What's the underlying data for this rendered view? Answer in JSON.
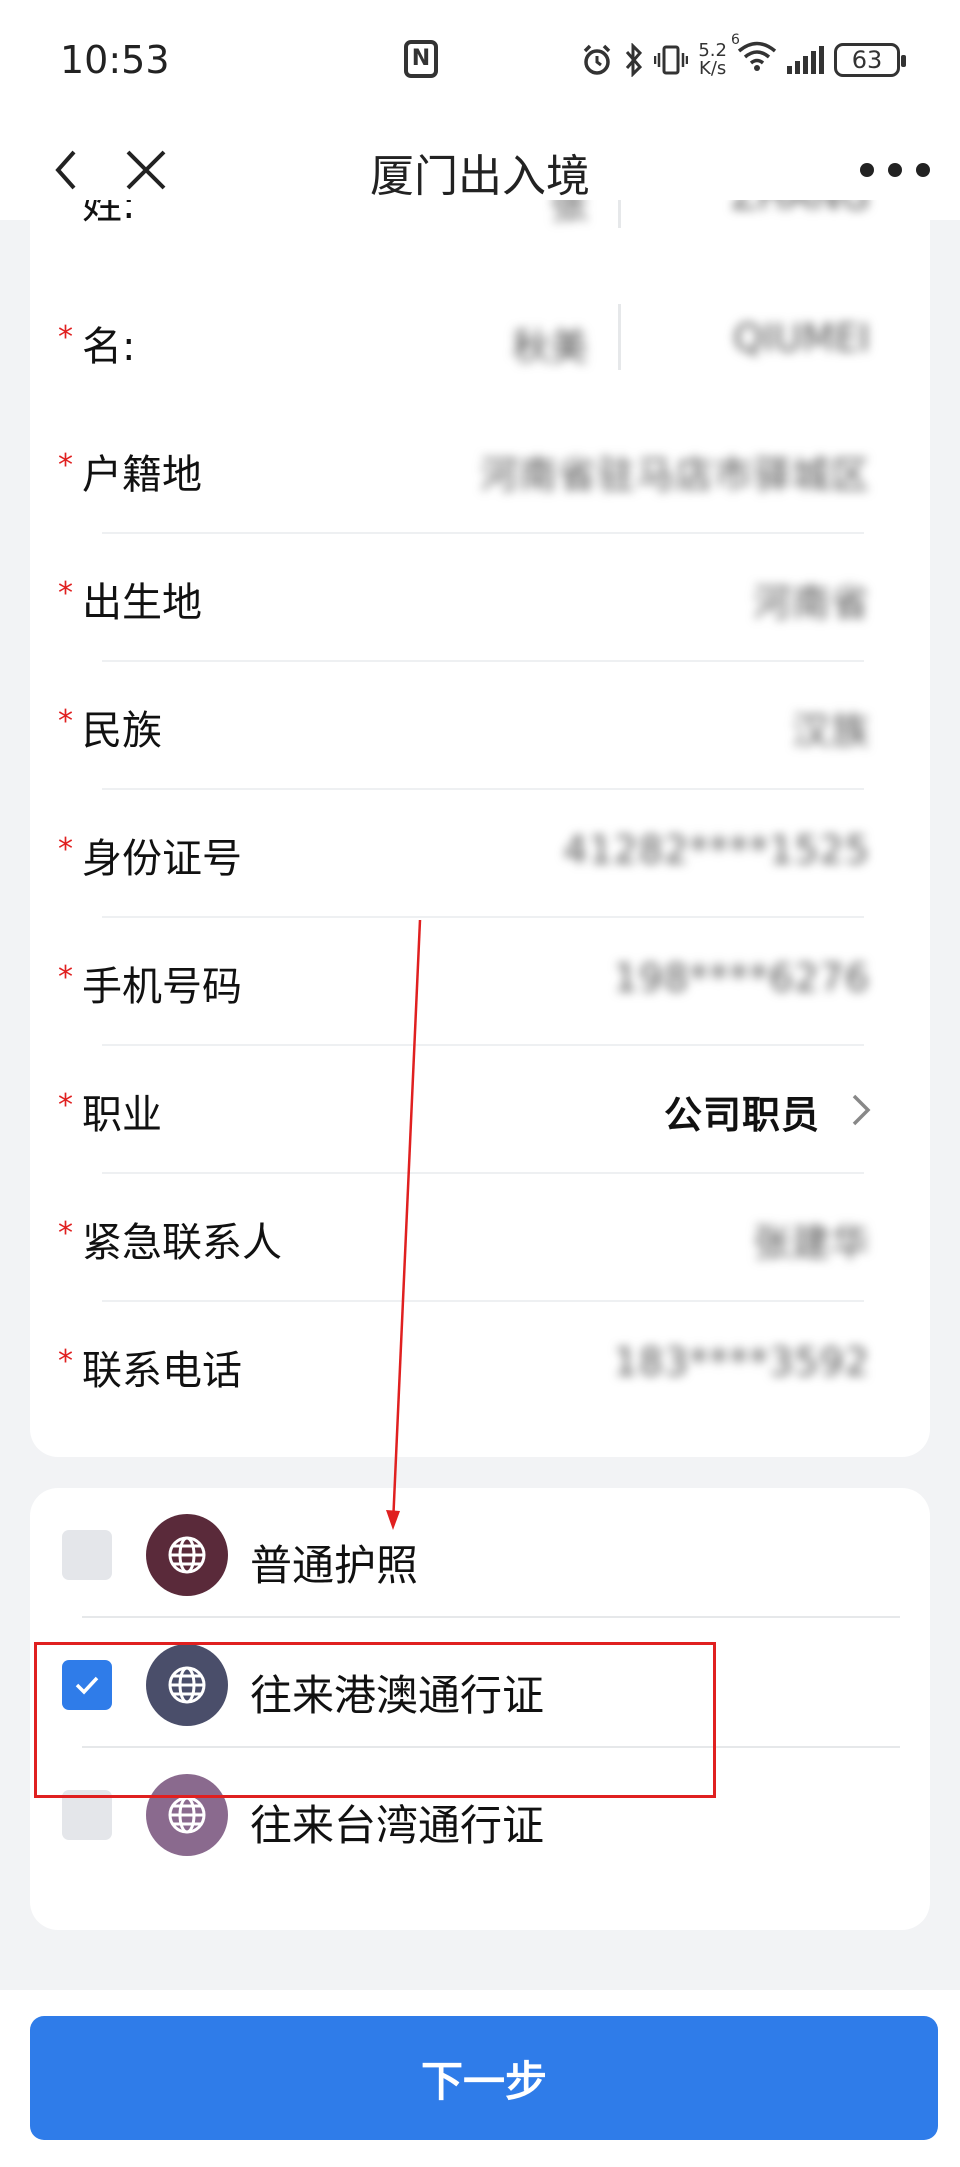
{
  "status_bar": {
    "time": "10:53",
    "nfc": "N",
    "net_speed_top": "5.2",
    "net_speed_bottom": "K/s",
    "wifi_gen": "6",
    "battery": "63"
  },
  "navbar": {
    "title": "厦门出入境",
    "back_icon": "chevron-left-icon",
    "close_icon": "close-icon",
    "more_icon": "more-icon"
  },
  "form": {
    "required_mark": "*",
    "surname": {
      "label": "姓:",
      "value_cn": "张",
      "value_en": "ZHANG"
    },
    "given_name": {
      "label": "名:",
      "value_cn": "秋美",
      "value_en": "QIUMEI"
    },
    "rows": [
      {
        "label": "户籍地",
        "value": "河南省驻马店市驿城区"
      },
      {
        "label": "出生地",
        "value": "河南省"
      },
      {
        "label": "民族",
        "value": "汉族"
      },
      {
        "label": "身份证号",
        "value": "41282****1525"
      },
      {
        "label": "手机号码",
        "value": "198****6276"
      },
      {
        "label": "职业",
        "value": "公司职员"
      },
      {
        "label": "紧急联系人",
        "value": "张建华"
      },
      {
        "label": "联系电话",
        "value": "183****3592"
      }
    ]
  },
  "documents": [
    {
      "label": "普通护照",
      "checked": false,
      "icon": "globe-icon",
      "color": "#5a2a3a"
    },
    {
      "label": "往来港澳通行证",
      "checked": true,
      "icon": "globe-icon",
      "color": "#4a4e6a"
    },
    {
      "label": "往来台湾通行证",
      "checked": false,
      "icon": "globe-icon",
      "color": "#8a6a8e"
    }
  ],
  "next_button": "下一步",
  "colors": {
    "accent": "#2f7ce9",
    "required": "#e02020",
    "annotation": "#e02020"
  }
}
